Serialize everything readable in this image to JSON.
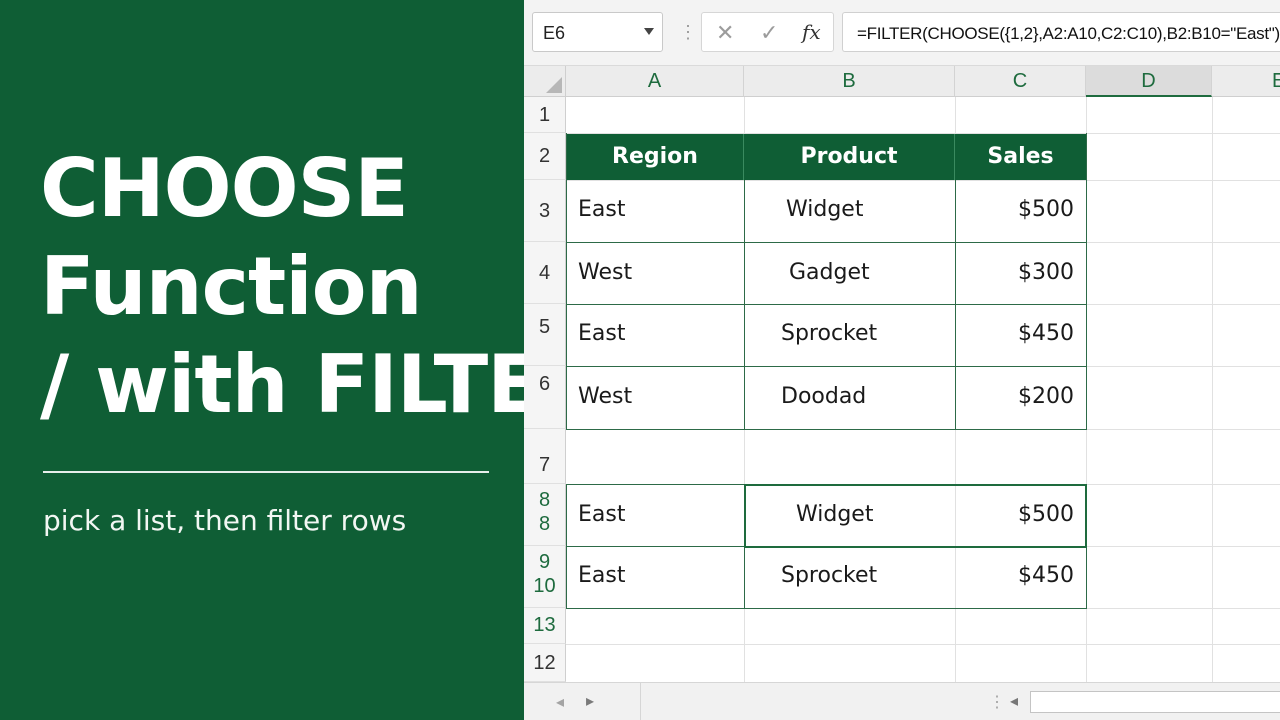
{
  "hero": {
    "title_line1": "CHOOSE",
    "title_line2": "Function",
    "title_line3": "/ with FILTER",
    "subtitle": "pick a list, then filter rows",
    "background": "#0f5e35"
  },
  "formula_bar": {
    "name_box": "E6",
    "separator": "⋮",
    "cancel_icon": "✕",
    "enter_icon": "✓",
    "fx_label": "fx",
    "formula": "=FILTER(CHOOSE({1,2},A2:A10,C2:C10),B2:B10=\"East\")"
  },
  "columns": [
    "A",
    "B",
    "C",
    "D",
    "E"
  ],
  "active_column": "D",
  "rows": {
    "r1": [
      "1"
    ],
    "r2": [
      "2"
    ],
    "r3": [
      "3"
    ],
    "r4": [
      "4"
    ],
    "r5": [
      "5"
    ],
    "r6": [
      "6"
    ],
    "r7": [
      "7"
    ],
    "r8": [
      "8",
      "8"
    ],
    "r9": [
      "9",
      "10"
    ],
    "r13": [
      "13"
    ],
    "r12": [
      "12"
    ]
  },
  "table": {
    "headers": [
      "Region",
      "Product",
      "Sales"
    ],
    "rows": [
      [
        "East",
        "Widget",
        "$500"
      ],
      [
        "West",
        "Gadget",
        "$300"
      ],
      [
        "East",
        "Sprocket",
        "$450"
      ],
      [
        "West",
        "Doodad",
        "$200"
      ]
    ]
  },
  "result": {
    "rows": [
      [
        "East",
        "Widget",
        "$500"
      ],
      [
        "East",
        "Sprocket",
        "$450"
      ]
    ]
  },
  "bottom_bar": {
    "prev_icon": "◂",
    "next_icon": "▸",
    "dots": "⋮",
    "scroll_left_icon": "◂"
  },
  "accent_color": "#1e6b3e"
}
